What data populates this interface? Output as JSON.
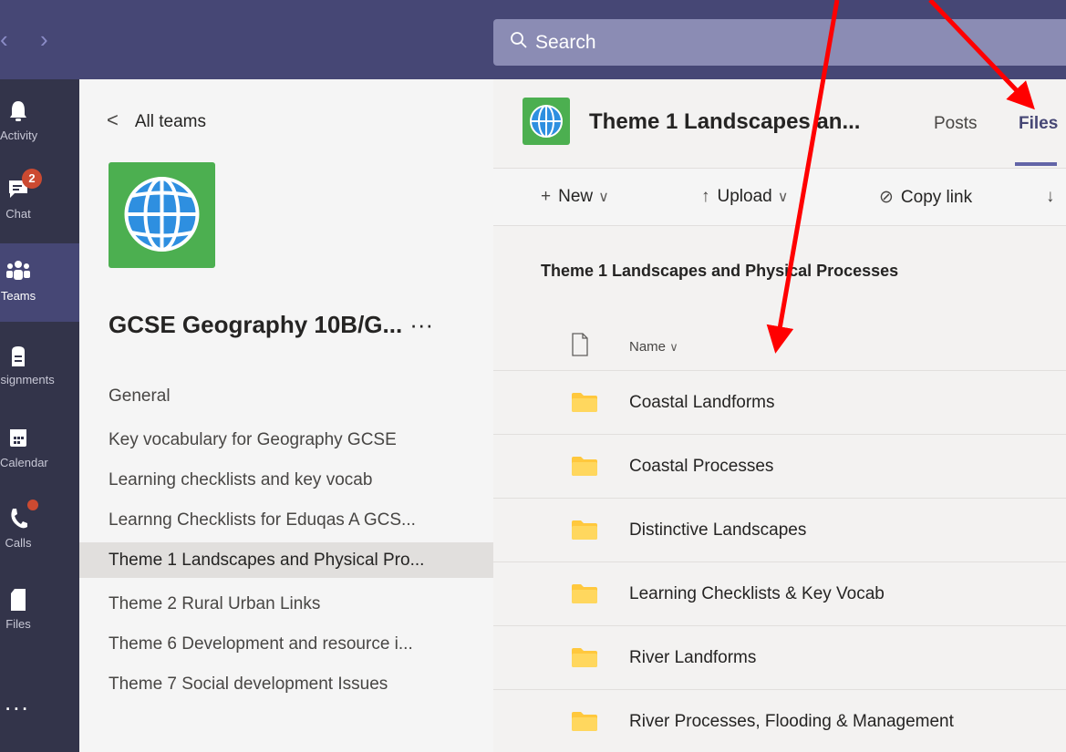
{
  "nav": {
    "back_arrow": "‹",
    "forward_arrow": "›"
  },
  "search": {
    "placeholder": "Search"
  },
  "rail": {
    "items": [
      {
        "label": "Activity",
        "icon": "bell-icon"
      },
      {
        "label": "Chat",
        "icon": "chat-icon",
        "badge": "2"
      },
      {
        "label": "Teams",
        "icon": "teams-icon",
        "active": true
      },
      {
        "label": "ssignments",
        "icon": "assignments-icon"
      },
      {
        "label": "Calendar",
        "icon": "calendar-icon"
      },
      {
        "label": "Calls",
        "icon": "phone-icon",
        "has_dot": true
      },
      {
        "label": "Files",
        "icon": "file-icon"
      }
    ],
    "more": "..."
  },
  "team": {
    "back_label": "All teams",
    "name": "GCSE Geography 10B/G...",
    "more": "···",
    "channels": [
      "General",
      "Key vocabulary for Geography GCSE",
      "Learning checklists and key vocab",
      "Learnng Checklists for Eduqas A GCS...",
      "Theme 1 Landscapes and Physical Pro...",
      "Theme 2 Rural Urban Links",
      "Theme 6 Development and resource i...",
      "Theme 7 Social development Issues"
    ],
    "selected_index": 4
  },
  "channel": {
    "title": "Theme 1 Landscapes an...",
    "tabs": {
      "posts": "Posts",
      "files": "Files"
    },
    "toolbar": {
      "new": "New",
      "upload": "Upload",
      "copy_link": "Copy link"
    },
    "breadcrumb": "Theme 1 Landscapes and Physical Processes",
    "column_name": "Name",
    "folders": [
      "Coastal Landforms",
      "Coastal Processes",
      "Distinctive Landscapes",
      "Learning Checklists & Key Vocab",
      "River Landforms",
      "River Processes, Flooding & Management"
    ]
  },
  "colors": {
    "titlebar": "#464775",
    "rail": "#33344a",
    "accent": "#6264a7",
    "annotation": "#ff0000",
    "folder": "#ffc83d"
  }
}
